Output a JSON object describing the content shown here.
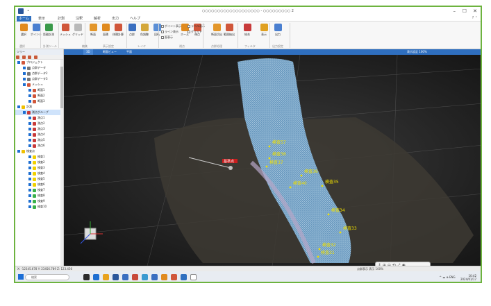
{
  "window": {
    "title": "○○○○○○○○○○○○○○○○○○○ - ○○○○○○○○○ 2",
    "app_dot": "•",
    "minimize": "–",
    "maximize": "☐",
    "close": "✕"
  },
  "ribbon_tabs": [
    "ホーム",
    "表示",
    "計測",
    "注釈",
    "解析",
    "出力",
    "ヘルプ"
  ],
  "ribbon_help": "? ⌃",
  "ribbon": {
    "buttons": [
      {
        "label": "選択",
        "icon": "select-icon",
        "color": "#e08a1e"
      },
      {
        "label": "ポイント",
        "icon": "point-icon",
        "color": "#4a7fd0"
      },
      {
        "label": "距離計測",
        "icon": "distance-icon",
        "color": "#3a9a4a"
      },
      {
        "label": "メッシュ",
        "icon": "mesh-icon",
        "color": "#d0563a"
      },
      {
        "label": "グリッド",
        "icon": "grid-icon",
        "color": "#b9b9b9"
      },
      {
        "label": "断面",
        "icon": "section-icon",
        "color": "#e3962a"
      },
      {
        "label": "面積",
        "icon": "area-icon",
        "color": "#e08a1e"
      },
      {
        "label": "体積計算",
        "icon": "volume-icon",
        "color": "#d0563a"
      },
      {
        "label": "点群",
        "icon": "cloud-icon",
        "color": "#3a6fc0"
      },
      {
        "label": "色調整",
        "icon": "color-icon",
        "color": "#d4a73a"
      },
      {
        "label": "回転",
        "icon": "rotate-icon",
        "color": "#5b8fd6"
      },
      {
        "label": "ホーム",
        "icon": "home-icon",
        "color": "#e08a1e"
      },
      {
        "label": "視点",
        "icon": "view-icon",
        "color": "#d0563a"
      },
      {
        "label": "断面切出",
        "icon": "cut-icon",
        "color": "#e3962a"
      },
      {
        "label": "範囲抽出",
        "icon": "extract-icon",
        "color": "#d0563a"
      },
      {
        "label": "結合",
        "icon": "merge-icon",
        "color": "#c83a3a"
      },
      {
        "label": "表示",
        "icon": "display-icon",
        "color": "#e0a020"
      },
      {
        "label": "出力",
        "icon": "export-icon",
        "color": "#4a7fd0"
      }
    ],
    "checkboxes": [
      "ポイント表示",
      "ライン表示",
      "面表示",
      "ラベル表示",
      "グリッド"
    ],
    "groups": [
      "選択",
      "計測ツール",
      "編集",
      "表示設定",
      "レイヤ",
      "視点",
      "点群処理",
      "フィルタ",
      "出力設定"
    ]
  },
  "sidebar": {
    "header": "ツリー",
    "items": [
      {
        "label": "プロジェクト",
        "level": 0,
        "icon_color": "#d0563a"
      },
      {
        "label": "点群データ",
        "level": 1,
        "icon_color": "#777"
      },
      {
        "label": "点群データ2",
        "level": 1,
        "icon_color": "#777"
      },
      {
        "label": "点群データ3",
        "level": 1,
        "icon_color": "#777"
      },
      {
        "label": "メッシュ",
        "level": 1,
        "icon_color": "#d0563a"
      },
      {
        "label": "断面1",
        "level": 2,
        "icon_color": "#d0563a"
      },
      {
        "label": "断面2",
        "level": 2,
        "icon_color": "#d0563a"
      },
      {
        "label": "断面3",
        "level": 2,
        "icon_color": "#d0563a"
      },
      {
        "label": "計測",
        "level": 0,
        "icon_color": "#f0c000"
      },
      {
        "label": "測点グループ",
        "level": 1,
        "icon_color": "#c83a3a",
        "selected": true
      },
      {
        "label": "測点1",
        "level": 2,
        "icon_color": "#c83a3a"
      },
      {
        "label": "測点2",
        "level": 2,
        "icon_color": "#c83a3a"
      },
      {
        "label": "測点3",
        "level": 2,
        "icon_color": "#c83a3a"
      },
      {
        "label": "測点4",
        "level": 2,
        "icon_color": "#c83a3a"
      },
      {
        "label": "測点5",
        "level": 2,
        "icon_color": "#c83a3a"
      },
      {
        "label": "測点6",
        "level": 2,
        "icon_color": "#c83a3a"
      },
      {
        "label": "検査点",
        "level": 0,
        "icon_color": "#f0c000"
      },
      {
        "label": "検査1",
        "level": 2,
        "icon_color": "#f0d000"
      },
      {
        "label": "検査2",
        "level": 2,
        "icon_color": "#f0d000"
      },
      {
        "label": "検査3",
        "level": 2,
        "icon_color": "#f0d000"
      },
      {
        "label": "検査4",
        "level": 2,
        "icon_color": "#f0d000"
      },
      {
        "label": "検査5",
        "level": 2,
        "icon_color": "#f0d000"
      },
      {
        "label": "検査6",
        "level": 2,
        "icon_color": "#f0d000"
      },
      {
        "label": "検査7",
        "level": 2,
        "icon_color": "#3ab04a"
      },
      {
        "label": "検査8",
        "level": 2,
        "icon_color": "#3ab04a"
      },
      {
        "label": "検査9",
        "level": 2,
        "icon_color": "#3ab04a"
      },
      {
        "label": "検査10",
        "level": 2,
        "icon_color": "#3ab04a"
      }
    ]
  },
  "viewport": {
    "tabs": [
      "3D",
      "断面ビュー",
      "平面"
    ],
    "toolbar_text": "表示設定  100%",
    "labels": [
      {
        "text": "検査57"
      },
      {
        "text": "検査38"
      },
      {
        "text": "検査37"
      },
      {
        "text": "検査36"
      },
      {
        "text": "検査40"
      },
      {
        "text": "検査35"
      },
      {
        "text": "検査34"
      },
      {
        "text": "検査33"
      },
      {
        "text": "検査32"
      },
      {
        "text": "検査31"
      }
    ],
    "red_label": "基準点"
  },
  "float_toolbar": "↕ ⊕ ⊖ ⟲ ⤢ ◉",
  "statusbar": "X: -12345.678  Y: 23456.789  Z: 123.456",
  "statusbar_right": "点群表示  表示 100%",
  "taskbar": {
    "search_placeholder": "検索",
    "time": "10:42",
    "date": "2024/01/17",
    "tray": "^ ☁ ⊕ ENG"
  }
}
